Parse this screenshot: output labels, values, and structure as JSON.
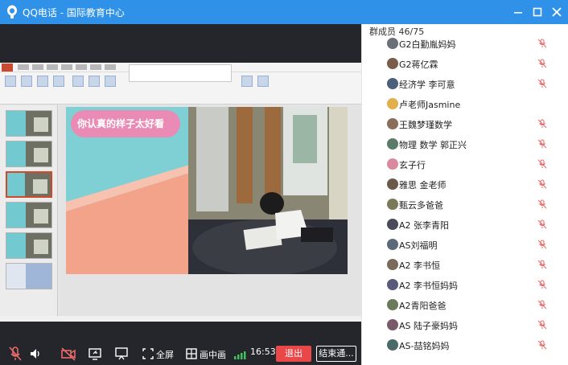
{
  "window": {
    "title": "QQ电话 - 国际教育中心",
    "controls": [
      "minimize",
      "maximize",
      "close"
    ]
  },
  "shared_screen": {
    "slide_caption": "你认真的样子太好看"
  },
  "call_controls": {
    "fullscreen_label": "全屏",
    "pip_label": "画中画",
    "timer": "16:53",
    "exit_label": "退出",
    "end_label": "结束通..."
  },
  "members": {
    "header": "群成员 46/75",
    "list": [
      {
        "name": "G2白勤胤妈妈",
        "muted": true
      },
      {
        "name": "G2蒋亿霖",
        "muted": true
      },
      {
        "name": "经济学 李可意",
        "muted": true
      },
      {
        "name": "卢老师Jasmine",
        "muted": false
      },
      {
        "name": "王魏梦瑾数学",
        "muted": true
      },
      {
        "name": "物理 数学 郭正兴",
        "muted": true
      },
      {
        "name": "玄子行",
        "muted": true
      },
      {
        "name": "雅思 金老师",
        "muted": true
      },
      {
        "name": "甄云多爸爸",
        "muted": true
      },
      {
        "name": "A2 张李青阳",
        "muted": true
      },
      {
        "name": "AS刘福明",
        "muted": true
      },
      {
        "name": "A2 李书恒",
        "muted": true
      },
      {
        "name": "A2 李书恒妈妈",
        "muted": true
      },
      {
        "name": "A2青阳爸爸",
        "muted": true
      },
      {
        "name": "AS 陆子豪妈妈",
        "muted": true
      },
      {
        "name": "AS-喆铭妈妈",
        "muted": true
      }
    ]
  },
  "colors": {
    "titlebar": "#2f92e8",
    "call_bg": "#24262b",
    "exit_button": "#e94748",
    "muted_icon": "#e96a6a"
  }
}
